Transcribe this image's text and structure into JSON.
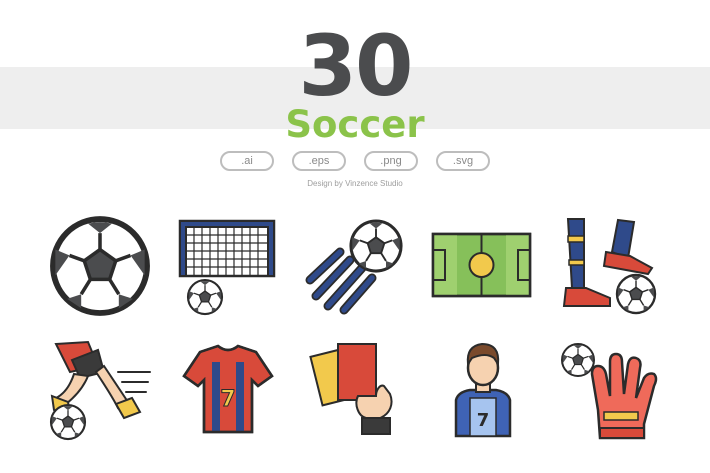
{
  "header": {
    "count": "30",
    "title": "Soccer",
    "credit": "Design by Vinzence Studio"
  },
  "formats": [
    ".ai",
    ".eps",
    ".png",
    ".svg"
  ],
  "icons": [
    "soccer-ball-icon",
    "goal-net-icon",
    "ball-kick-speed-icon",
    "soccer-field-icon",
    "player-legs-cleats-icon",
    "running-player-icon",
    "jersey-number-7-icon",
    "referee-cards-icon",
    "player-number-7-icon",
    "goalkeeper-glove-icon"
  ],
  "jersey_number": "7",
  "colors": {
    "heading": "#4b4c4e",
    "accent_green": "#8bc34a",
    "band": "#eeeeee",
    "outline": "#2b2b2b",
    "navy": "#2f4a8a",
    "red": "#d84a3a",
    "field_green": "#86c05a",
    "yellow": "#f2c94c"
  }
}
